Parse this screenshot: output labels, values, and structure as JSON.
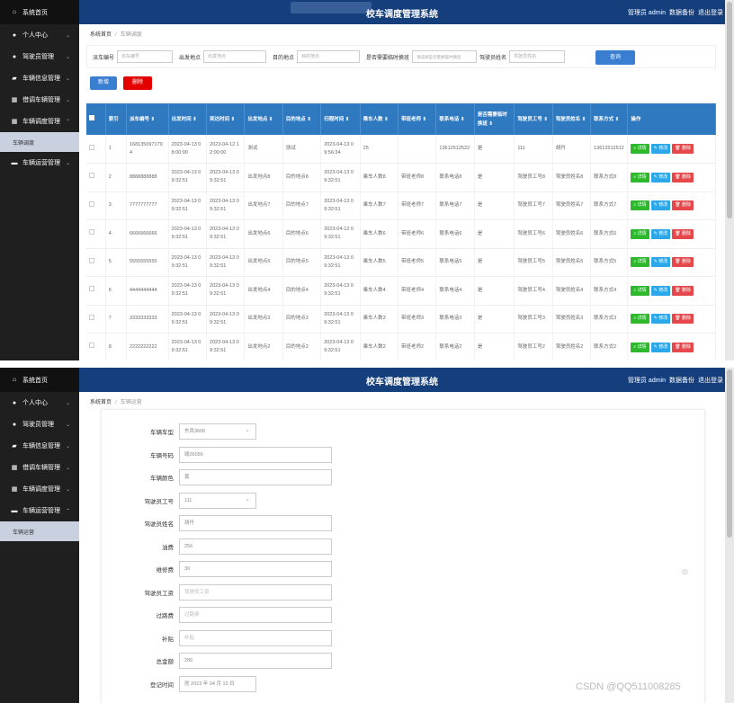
{
  "app_title": "校车调度管理系统",
  "topbar_links": [
    "管理员 admin",
    "数据备份",
    "退出登录"
  ],
  "sidebar": {
    "home": "系统首页",
    "items": [
      {
        "label": "个人中心",
        "icon": "person-icon"
      },
      {
        "label": "驾驶员管理",
        "icon": "person-icon"
      },
      {
        "label": "车辆信息管理",
        "icon": "car-icon"
      },
      {
        "label": "借调车辆管理",
        "icon": "grid-icon"
      },
      {
        "label": "车辆调度管理",
        "icon": "grid-icon"
      },
      {
        "label": "车辆运营管理",
        "icon": "monitor-icon"
      }
    ],
    "sub_dispatch": "车辆调度",
    "sub_ops": "车辆运营"
  },
  "page1": {
    "breadcrumb": {
      "home": "系统首页",
      "current": "车辆调度"
    },
    "search": [
      {
        "label": "派车编号",
        "placeholder": "派车编号"
      },
      {
        "label": "出发地点",
        "placeholder": "出发地点"
      },
      {
        "label": "目的地点",
        "placeholder": "目的地点"
      },
      {
        "label": "是否需要临时换班",
        "placeholder": "请选择是否需要临时换班"
      },
      {
        "label": "驾驶员姓名",
        "placeholder": "驾驶员姓名"
      }
    ],
    "query_button": "查询",
    "add_button": "新增",
    "delete_button": "删除",
    "table": {
      "headers": [
        "索引",
        "派车编号 ⇕",
        "出发时间 ⇕",
        "到达时间 ⇕",
        "出发地点 ⇕",
        "目的地点 ⇕",
        "归程时间 ⇕",
        "乘车人数 ⇕",
        "带班老师 ⇕",
        "联系电话 ⇕",
        "是否需要临时换班 ⇕",
        "驾驶员工号 ⇕",
        "驾驶员姓名 ⇕",
        "联系方式 ⇕",
        "操作"
      ],
      "rows": [
        [
          "1",
          "1681350971794",
          "2023-04-13 08:00:00",
          "2023-04-12 12:00:00",
          "测试",
          "测试",
          "2023-04-13 09:56:34",
          "25",
          "",
          "13612512522",
          "是",
          "111",
          "胡丹",
          "13612512512"
        ],
        [
          "2",
          "8888888888",
          "2023-04-13 09:32:51",
          "2023-04-13 09:32:51",
          "出发地点8",
          "目的地点8",
          "2023-04-13 09:32:51",
          "乘车人数8",
          "带班老师8",
          "联系电话8",
          "是",
          "驾驶员工号8",
          "驾驶员姓名8",
          "联系方式8"
        ],
        [
          "3",
          "7777777777",
          "2023-04-13 09:32:51",
          "2023-04-13 09:32:51",
          "出发地点7",
          "目的地点7",
          "2023-04-13 09:32:51",
          "乘车人数7",
          "带班老师7",
          "联系电话7",
          "是",
          "驾驶员工号7",
          "驾驶员姓名7",
          "联系方式7"
        ],
        [
          "4",
          "6666666666",
          "2023-04-13 09:32:51",
          "2023-04-13 09:32:51",
          "出发地点6",
          "目的地点6",
          "2023-04-13 09:32:51",
          "乘车人数6",
          "带班老师6",
          "联系电话6",
          "是",
          "驾驶员工号6",
          "驾驶员姓名6",
          "联系方式6"
        ],
        [
          "5",
          "5555555555",
          "2023-04-13 09:32:51",
          "2023-04-13 09:32:51",
          "出发地点5",
          "目的地点5",
          "2023-04-13 09:32:51",
          "乘车人数5",
          "带班老师5",
          "联系电话5",
          "是",
          "驾驶员工号5",
          "驾驶员姓名5",
          "联系方式5"
        ],
        [
          "6",
          "4444444444",
          "2023-04-13 09:32:51",
          "2023-04-13 09:32:51",
          "出发地点4",
          "目的地点4",
          "2023-04-13 09:32:51",
          "乘车人数4",
          "带班老师4",
          "联系电话4",
          "是",
          "驾驶员工号4",
          "驾驶员姓名4",
          "联系方式4"
        ],
        [
          "7",
          "3333333333",
          "2023-04-13 09:32:51",
          "2023-04-13 09:32:51",
          "出发地点3",
          "目的地点3",
          "2023-04-13 09:32:51",
          "乘车人数3",
          "带班老师3",
          "联系电话3",
          "是",
          "驾驶员工号3",
          "驾驶员姓名3",
          "联系方式3"
        ],
        [
          "8",
          "2222222222",
          "2023-04-13 09:32:51",
          "2023-04-13 09:32:51",
          "出发地点2",
          "目的地点2",
          "2023-04-13 09:32:51",
          "乘车人数2",
          "带班老师2",
          "联系电话2",
          "是",
          "驾驶员工号2",
          "驾驶员姓名2",
          "联系方式2"
        ]
      ],
      "ops": {
        "view": "详情",
        "edit": "修改",
        "delete": "删除"
      }
    }
  },
  "page2": {
    "breadcrumb": {
      "home": "系统首页",
      "current": "车辆运营"
    },
    "fields": [
      {
        "label": "车辆车型",
        "value": "东风3606",
        "type": "select"
      },
      {
        "label": "车辆号码",
        "value": "赣26056",
        "type": "text"
      },
      {
        "label": "车辆颜色",
        "value": "黄",
        "type": "text"
      },
      {
        "label": "驾驶员工号",
        "value": "111",
        "type": "select"
      },
      {
        "label": "驾驶员姓名",
        "value": "胡丹",
        "type": "text"
      },
      {
        "label": "油费",
        "value": "256",
        "type": "text"
      },
      {
        "label": "维修费",
        "value": "30",
        "type": "text"
      },
      {
        "label": "驾驶员工资",
        "value": "驾驶员工资",
        "type": "placeholder"
      },
      {
        "label": "过路费",
        "value": "过路费",
        "type": "placeholder"
      },
      {
        "label": "补贴",
        "value": "补贴",
        "type": "placeholder"
      },
      {
        "label": "总金额",
        "value": "286",
        "type": "text"
      },
      {
        "label": "登记时间",
        "value": "2023 年 04 月 13 日",
        "type": "date"
      }
    ],
    "watermark": "CSDN @QQ511008285"
  }
}
